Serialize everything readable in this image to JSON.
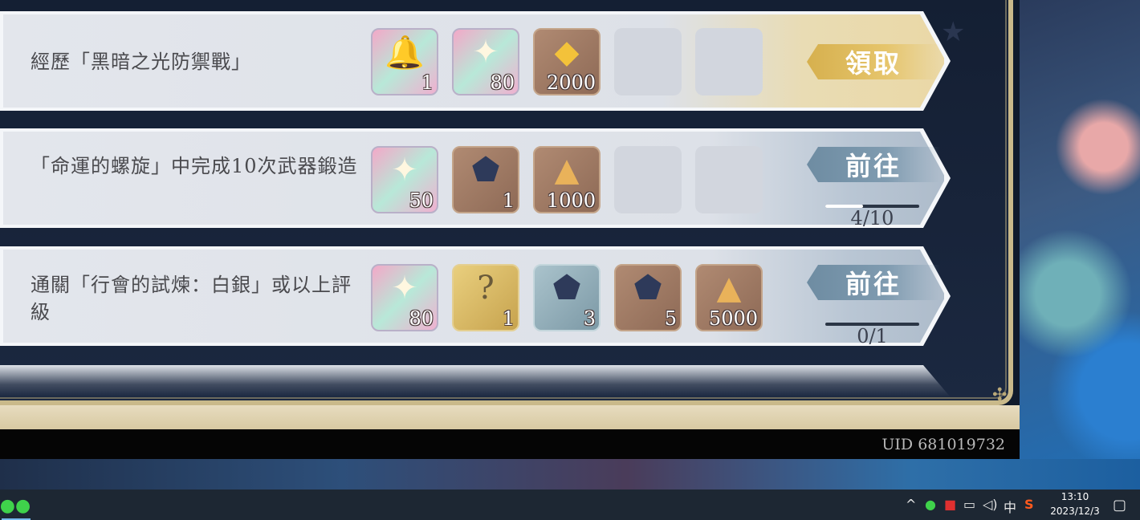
{
  "quests": [
    {
      "title": "經歷「黑暗之光防禦戰」",
      "rewards": [
        {
          "item": "bell-lantern-icon",
          "qty": "1"
        },
        {
          "item": "star-crystal-icon",
          "qty": "80"
        },
        {
          "item": "gold-ingot-icon",
          "qty": "2000"
        }
      ],
      "action": "領取"
    },
    {
      "title": "「命運的螺旋」中完成10次武器鍛造",
      "rewards": [
        {
          "item": "star-crystal-icon",
          "qty": "50"
        },
        {
          "item": "dark-ore-icon",
          "qty": "1"
        },
        {
          "item": "gold-pile-icon",
          "qty": "1000"
        }
      ],
      "action": "前往",
      "progress": {
        "text": "4/10",
        "fraction": 0.4
      }
    },
    {
      "title": "通關「行會的試煉：白銀」或以上評級",
      "rewards": [
        {
          "item": "star-crystal-icon",
          "qty": "80"
        },
        {
          "item": "mystery-weapon-icon",
          "qty": "1"
        },
        {
          "item": "dark-ore-icon",
          "qty": "3"
        },
        {
          "item": "dark-ore-icon",
          "qty": "5"
        },
        {
          "item": "gold-pile-icon",
          "qty": "5000"
        }
      ],
      "action": "前往",
      "progress": {
        "text": "0/1",
        "fraction": 0
      }
    }
  ],
  "uid": "UID 681019732",
  "taskbar": {
    "ime": "中",
    "time": "13:10",
    "date": "2023/12/3"
  },
  "colors": {
    "claim_button": "#d6b04e",
    "go_button": "#6e8ca2"
  }
}
